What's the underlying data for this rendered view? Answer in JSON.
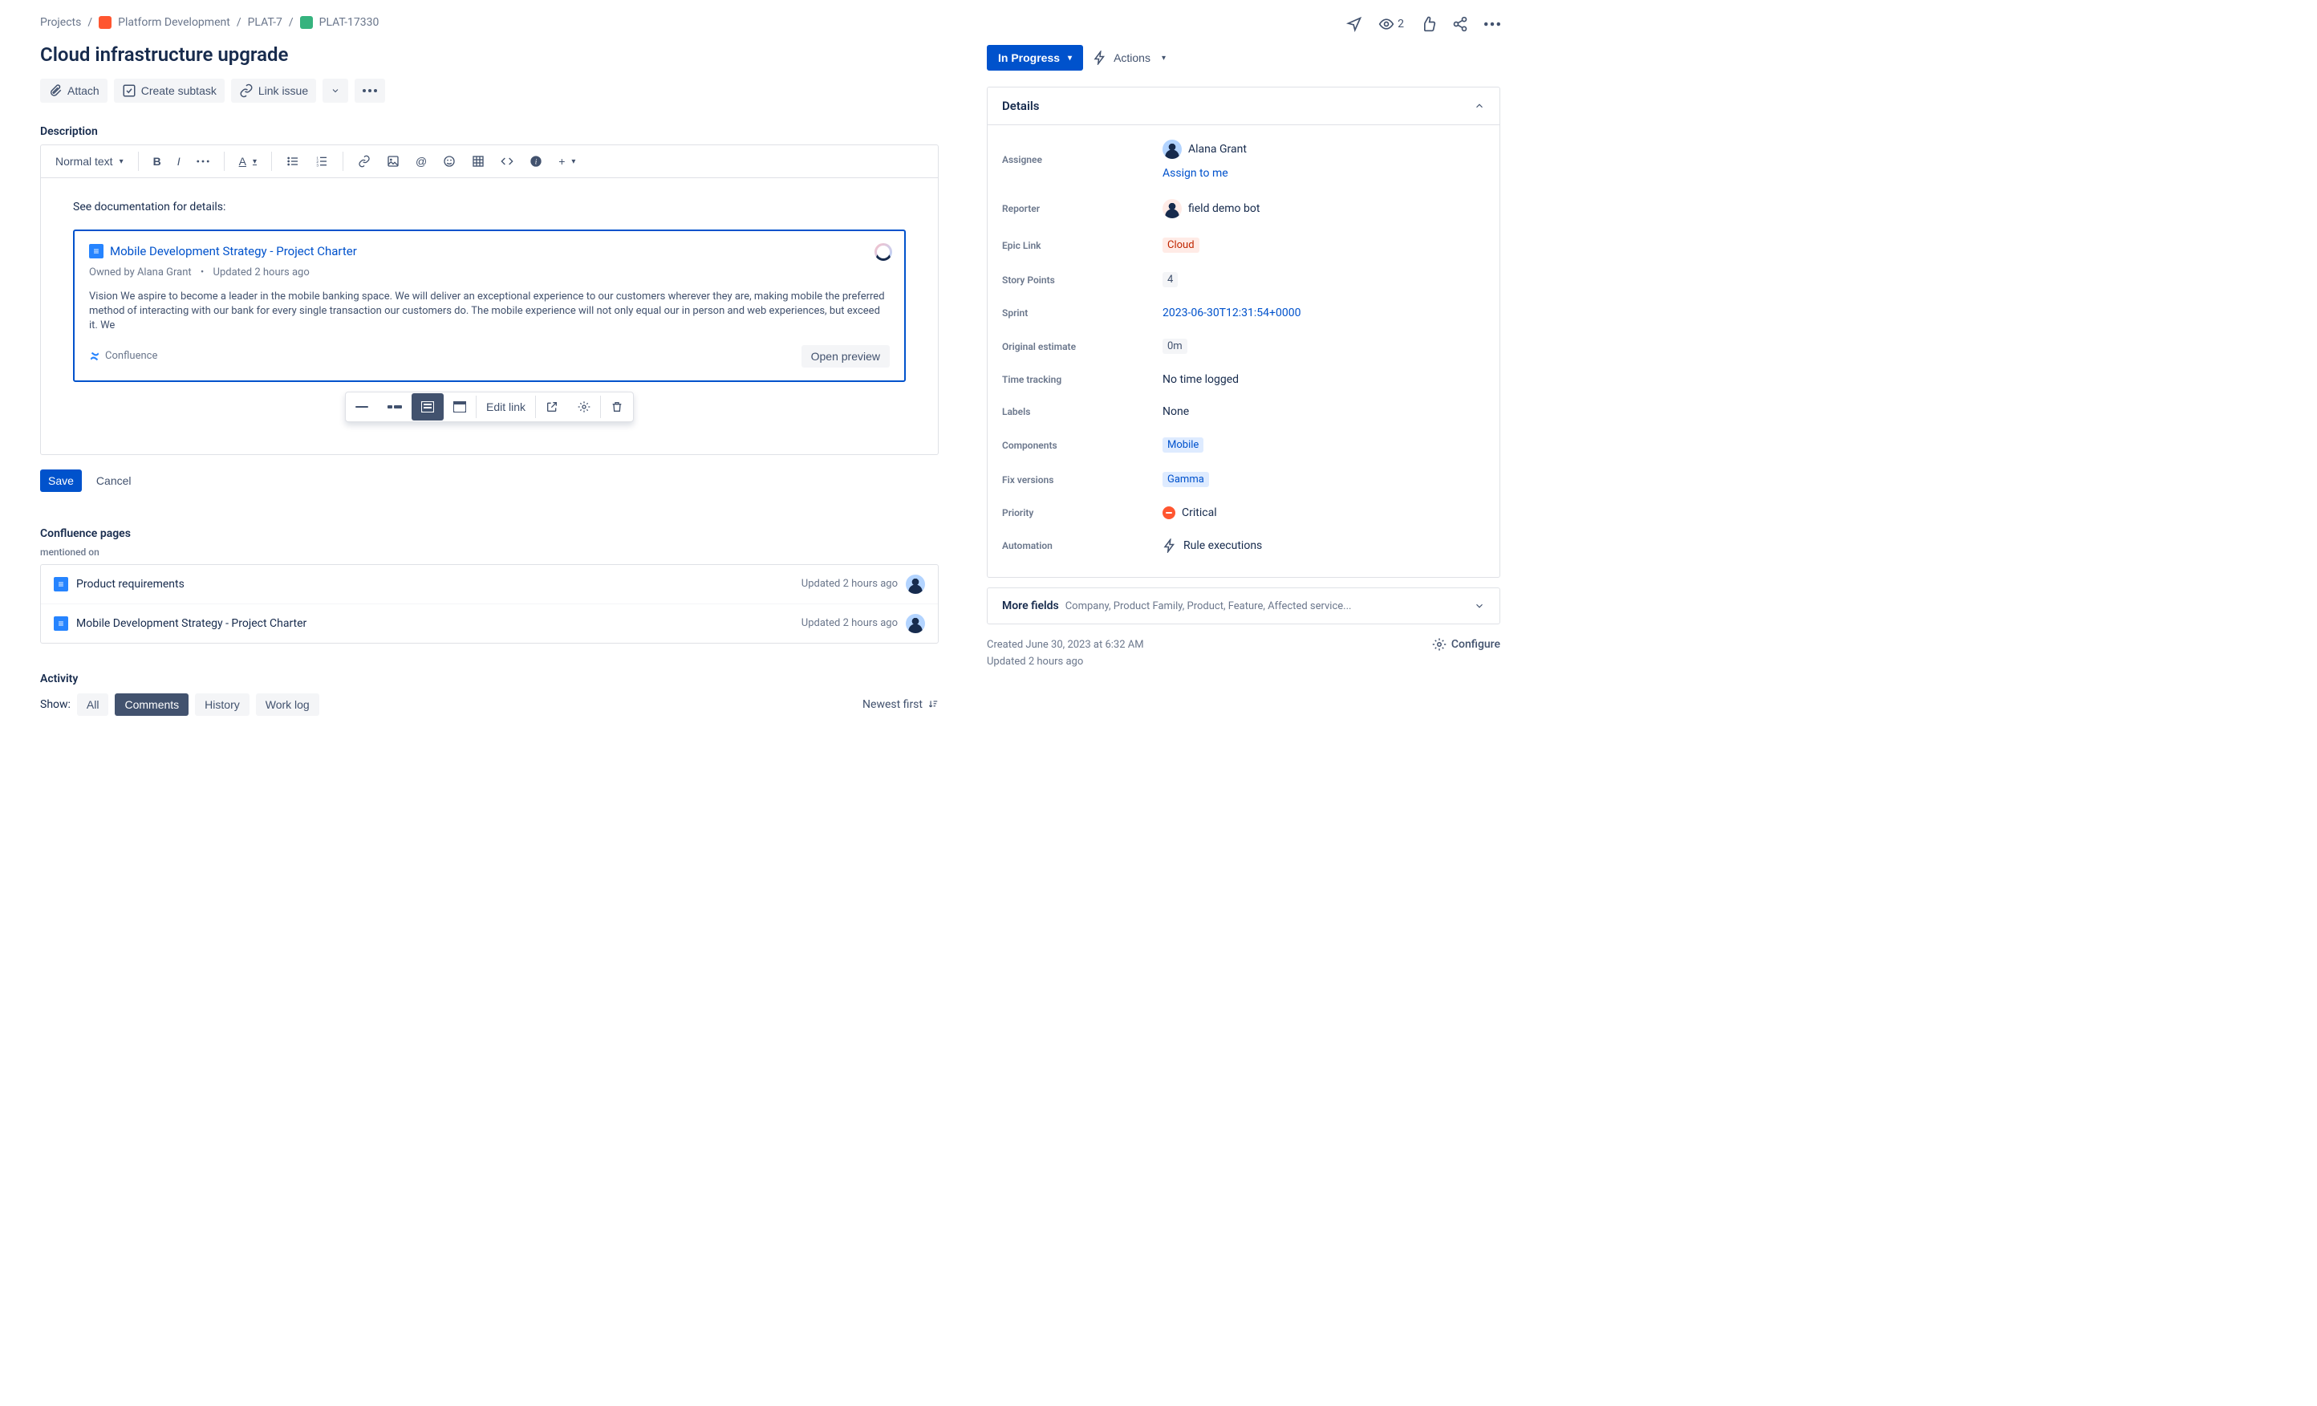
{
  "breadcrumb": {
    "projects": "Projects",
    "project": "Platform Development",
    "epic": "PLAT-7",
    "issue": "PLAT-17330"
  },
  "title": "Cloud infrastructure upgrade",
  "mainActions": {
    "attach": "Attach",
    "createSubtask": "Create subtask",
    "linkIssue": "Link issue"
  },
  "description": {
    "label": "Description",
    "textStyle": "Normal text",
    "bodyIntro": "See documentation for details:",
    "smartlink": {
      "title": "Mobile Development Strategy - Project Charter",
      "ownedBy": "Owned by Alana Grant",
      "updated": "Updated 2 hours ago",
      "snippet": "Vision We aspire to become a leader in the mobile banking space. We will deliver an exceptional experience to our customers wherever they are, making mobile the preferred method of interacting with our bank for every single transaction our customers do. The mobile experience will not only equal our in person and web experiences, but exceed it. We",
      "source": "Confluence",
      "openPreview": "Open preview"
    },
    "floating": {
      "editLink": "Edit link"
    },
    "save": "Save",
    "cancel": "Cancel"
  },
  "confluence": {
    "heading": "Confluence pages",
    "mentioned": "mentioned on",
    "pages": [
      {
        "name": "Product requirements",
        "updated": "Updated 2 hours ago"
      },
      {
        "name": "Mobile Development Strategy - Project Charter",
        "updated": "Updated 2 hours ago"
      }
    ]
  },
  "activity": {
    "heading": "Activity",
    "show": "Show:",
    "tabs": {
      "all": "All",
      "comments": "Comments",
      "history": "History",
      "worklog": "Work log"
    },
    "sort": "Newest first"
  },
  "topBar": {
    "watchers": "2"
  },
  "status": {
    "label": "In Progress",
    "actions": "Actions"
  },
  "details": {
    "heading": "Details",
    "fields": {
      "assigneeLabel": "Assignee",
      "assignee": "Alana Grant",
      "assignToMe": "Assign to me",
      "reporterLabel": "Reporter",
      "reporter": "field demo bot",
      "epicLabel": "Epic Link",
      "epic": "Cloud",
      "storyLabel": "Story Points",
      "story": "4",
      "sprintLabel": "Sprint",
      "sprint": "2023-06-30T12:31:54+0000",
      "estimateLabel": "Original estimate",
      "estimate": "0m",
      "timeLabel": "Time tracking",
      "time": "No time logged",
      "labelsLabel": "Labels",
      "labels": "None",
      "componentsLabel": "Components",
      "components": "Mobile",
      "fixLabel": "Fix versions",
      "fix": "Gamma",
      "priorityLabel": "Priority",
      "priority": "Critical",
      "automationLabel": "Automation",
      "automation": "Rule executions"
    }
  },
  "moreFields": {
    "label": "More fields",
    "sub": "Company, Product Family, Product, Feature, Affected service..."
  },
  "timestamps": {
    "created": "Created June 30, 2023 at 6:32 AM",
    "updated": "Updated 2 hours ago",
    "configure": "Configure"
  }
}
